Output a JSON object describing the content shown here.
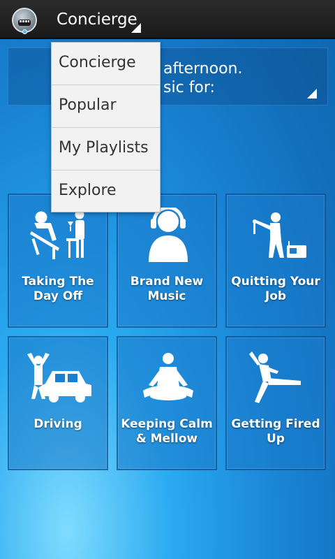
{
  "header": {
    "app_logo": "songza-logo-icon",
    "nav_title": "Concierge"
  },
  "greeting": {
    "line1": "afternoon.",
    "line2": "sic for:"
  },
  "dropdown": {
    "items": [
      {
        "label": "Concierge"
      },
      {
        "label": "Popular"
      },
      {
        "label": "My Playlists"
      },
      {
        "label": "Explore"
      }
    ]
  },
  "tiles": [
    {
      "label": "Taking The Day Off",
      "icon": "lounger-with-waiter-icon"
    },
    {
      "label": "Brand New Music",
      "icon": "headphones-person-icon"
    },
    {
      "label": "Quitting Your Job",
      "icon": "golfer-radio-icon"
    },
    {
      "label": "Driving",
      "icon": "car-cheer-icon"
    },
    {
      "label": "Keeping Calm & Mellow",
      "icon": "meditating-person-icon"
    },
    {
      "label": "Getting Fired Up",
      "icon": "kicking-person-icon"
    }
  ],
  "colors": {
    "actionbar": "#1a1a1a",
    "background_accent": "#1a86d6",
    "dropdown_bg": "#f2f2f2"
  }
}
